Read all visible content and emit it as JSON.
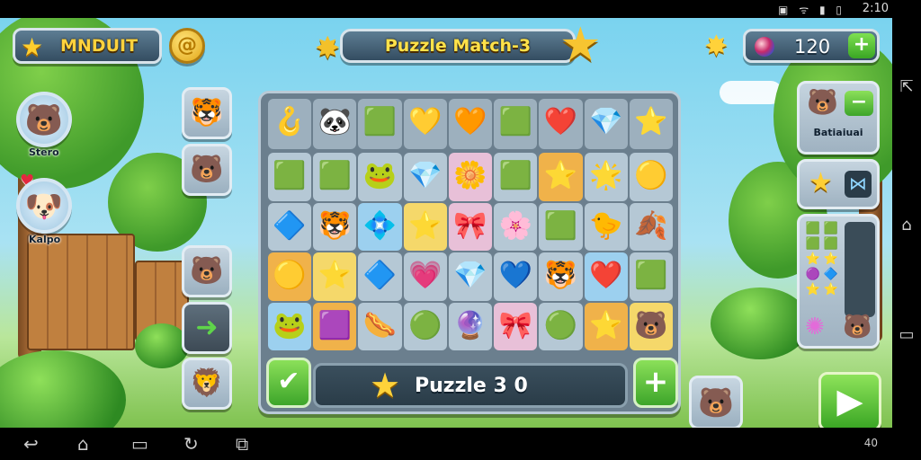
{
  "status_bar": {
    "icons": "▣ ᯤ ▮ ▯",
    "time": "2:10"
  },
  "hud": {
    "player_name": "MNDUIT",
    "coin_symbol": "@",
    "title": "Puzzle Match-3",
    "score": "120",
    "plus_label": "+"
  },
  "friends": [
    {
      "name": "Stero",
      "avatar": "🐻"
    },
    {
      "name": "Kalpo",
      "avatar": "🐶"
    }
  ],
  "left_slots": [
    "🐯",
    "🐻",
    "🐻",
    "➜",
    "🦁"
  ],
  "board": {
    "top_row": [
      "🪝",
      "🐼",
      "🟩",
      "💛",
      "🧡",
      "🟩",
      "❤️",
      "💎",
      "⭐"
    ],
    "grid": [
      [
        "🟩",
        "🟩",
        "🐸",
        "💎",
        "🌼",
        "🟩",
        "⭐",
        "🌟",
        "🟡"
      ],
      [
        "🔷",
        "🐯",
        "💠",
        "⭐",
        "🎀",
        "🌸",
        "🟩",
        "🐤",
        "🍂"
      ],
      [
        "🟡",
        "⭐",
        "🔷",
        "💗",
        "💎",
        "💙",
        "🐯",
        "❤️",
        "🟩"
      ],
      [
        "🐸",
        "🟪",
        "🌭",
        "🟢",
        "🔮",
        "🎀",
        "🟢",
        "⭐",
        "🐻"
      ]
    ],
    "puzzle_label": "Puzzle 3 0"
  },
  "right": {
    "panel1_name": "Batiaiuai",
    "panel2_bolt": "⋈",
    "mini_gems": [
      "🟩",
      "🟩",
      "🟩",
      "🟩",
      "⭐",
      "⭐",
      "🟣",
      "🔷",
      "⭐",
      "⭐"
    ]
  },
  "nav": {
    "back": "↩",
    "home": "⌂",
    "recent": "▭",
    "vol": "40"
  },
  "side_nav": {
    "top": "⇱",
    "mid": "⌂",
    "bot": "▭"
  },
  "colors": {
    "accent_green": "#3da52a",
    "hud_blue": "#344d61",
    "star_gold": "#ffd23a"
  }
}
